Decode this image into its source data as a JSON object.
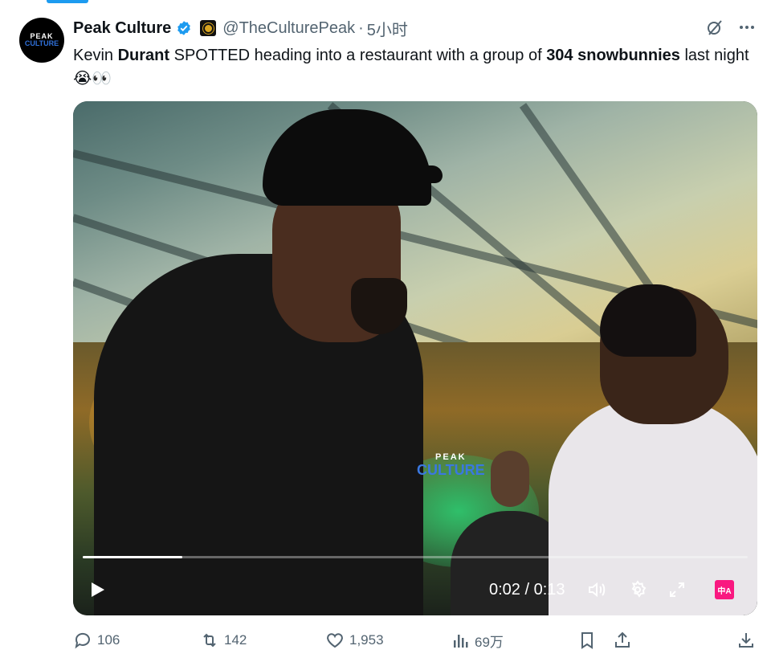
{
  "tweet": {
    "author_name": "Peak Culture",
    "handle": "@TheCulturePeak",
    "separator": "·",
    "time": "5小时",
    "text_parts": {
      "p1": "Kevin ",
      "b1": "Durant",
      "p2": " SPOTTED heading into a restaurant with a group of ",
      "b2": "304 snowbunnies",
      "p3": " last night ",
      "emoji": "😭👀"
    }
  },
  "avatar": {
    "line1": "PEAK",
    "line2": "CULTURE"
  },
  "video": {
    "watermark_line1": "PEAK",
    "watermark_line2": "CULTURE",
    "current_time": "0:02",
    "duration": "0:13",
    "time_readout": "0:02 / 0:13",
    "progress": 0.15,
    "translate_label": "中A"
  },
  "actions": {
    "replies": "106",
    "reposts": "142",
    "likes": "1,953",
    "views": "69万"
  },
  "colors": {
    "accent": "#1d9bf0",
    "text": "#0f1419",
    "muted": "#536471",
    "translate": "#f91880"
  },
  "icons": {
    "verified": "verified-badge-icon",
    "grok": "grok-icon",
    "more": "more-icon",
    "reply": "reply-icon",
    "repost": "repost-icon",
    "like": "like-icon",
    "views": "views-icon",
    "bookmark": "bookmark-icon",
    "share": "share-icon",
    "download": "download-icon"
  }
}
